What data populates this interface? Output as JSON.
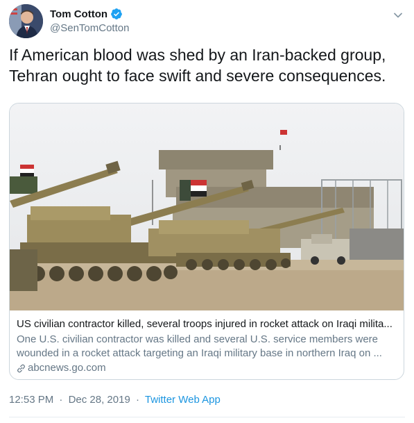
{
  "author": {
    "name": "Tom Cotton",
    "handle": "@SenTomCotton",
    "verified": true
  },
  "tweet": {
    "text": "If American blood was shed by an Iran-backed group,\nTehran ought to face swift and severe consequences."
  },
  "card": {
    "title": "US civilian contractor killed, several troops injured in rocket attack on Iraqi milita...",
    "description_line1": "One U.S. civilian contractor was killed and several U.S. service members were",
    "description_line2": "wounded in a rocket attack targeting an Iraqi military base in northern Iraq on ...",
    "domain": "abcnews.go.com"
  },
  "meta": {
    "time": "12:53 PM",
    "date": "Dec 28, 2019",
    "separator": "·",
    "source": "Twitter Web App"
  },
  "colors": {
    "verified": "#1da1f2",
    "link": "#1b95e0",
    "secondary_text": "#657786",
    "border": "#ccd6dd"
  },
  "icons": [
    "verified-badge-icon",
    "chevron-down-icon",
    "link-icon"
  ]
}
